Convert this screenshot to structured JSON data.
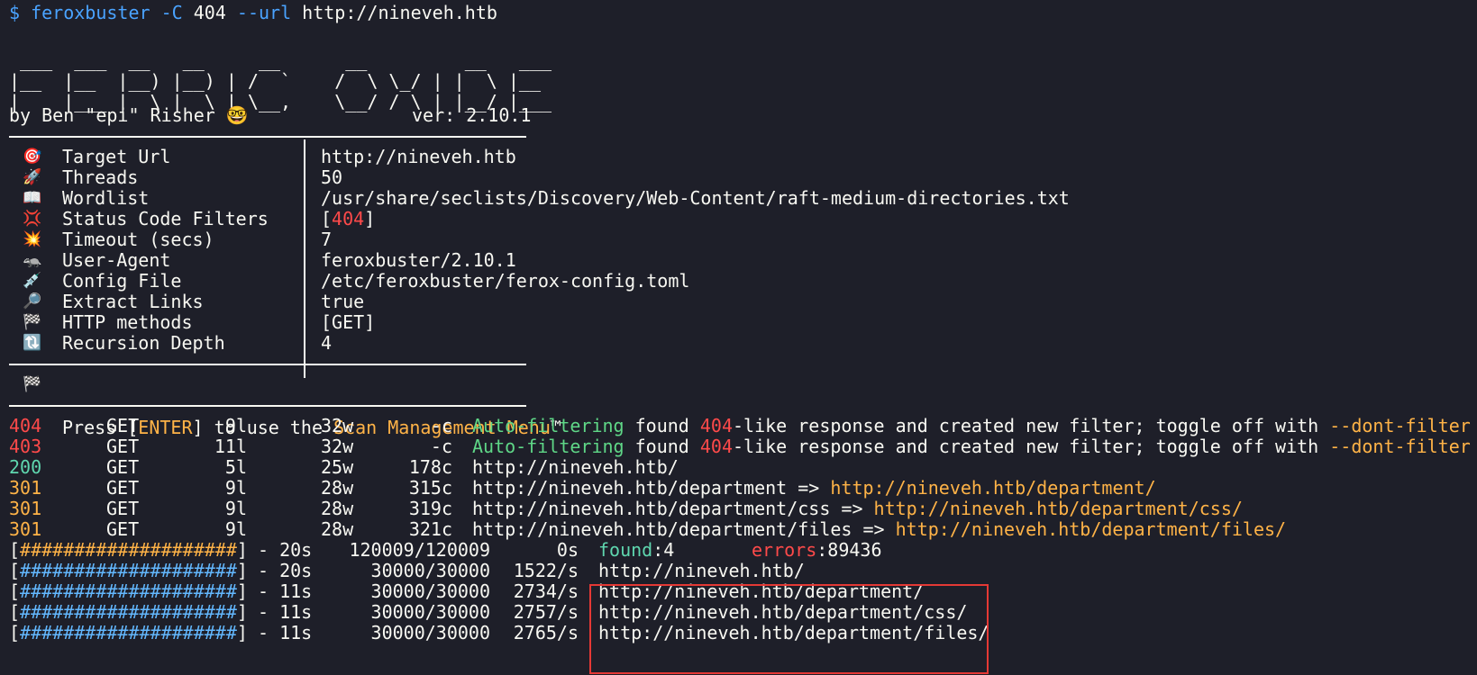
{
  "prompt": {
    "symbol": "$",
    "command": "feroxbuster",
    "flag1": "-C",
    "arg1": "404",
    "flag2": "--url",
    "arg2": "http://nineveh.htb"
  },
  "banner": {
    "ascii_art": " ___  ___  __   __     __      __         __   ___\n|__  |__  |__) |__) | /  `    /  \\ \\_/ | |  \\ |__\n|    |___ |  \\ |  \\ | \\__,    \\__/ / \\ | |__/ |___",
    "author": "by Ben \"epi\" Risher",
    "author_emoji": "🤓",
    "version": "ver: 2.10.1"
  },
  "config": [
    {
      "icon": "target-icon",
      "glyph": "🎯",
      "label": "Target Url",
      "value": "http://nineveh.htb"
    },
    {
      "icon": "rocket-icon",
      "glyph": "🚀",
      "label": "Threads",
      "value": "50"
    },
    {
      "icon": "book-icon",
      "glyph": "📖",
      "label": "Wordlist",
      "value": "/usr/share/seclists/Discovery/Web-Content/raft-medium-directories.txt"
    },
    {
      "icon": "collision-icon",
      "glyph": "💢",
      "label": "Status Code Filters",
      "value_prefix": "[",
      "value_code": "404",
      "value_suffix": "]"
    },
    {
      "icon": "boom-icon",
      "glyph": "💥",
      "label": "Timeout (secs)",
      "value": "7"
    },
    {
      "icon": "dog-icon",
      "glyph": "🦡",
      "label": "User-Agent",
      "value": "feroxbuster/2.10.1"
    },
    {
      "icon": "syringe-icon",
      "glyph": "💉",
      "label": "Config File",
      "value": "/etc/feroxbuster/ferox-config.toml"
    },
    {
      "icon": "magnifier-icon",
      "glyph": "🔎",
      "label": "Extract Links",
      "value": "true"
    },
    {
      "icon": "checkered-flag-icon",
      "glyph": "🏁",
      "label": "HTTP methods",
      "value": "[GET]"
    },
    {
      "icon": "loop-icon",
      "glyph": "🔃",
      "label": "Recursion Depth",
      "value": "4"
    }
  ],
  "menu_hint": {
    "glyph": "🏁",
    "pre": "Press ",
    "bracket_open": "[",
    "key": "ENTER",
    "bracket_close": "]",
    "mid": " to use the ",
    "menu": "Scan Management Menu",
    "tm": "™"
  },
  "results": [
    {
      "status": "404",
      "method": "GET",
      "lines": "9l",
      "words": "32w",
      "chars": "-c",
      "tag": "Auto-filtering",
      "msg1": " found ",
      "code": "404",
      "msg2": "-like response and created new filter; toggle off with ",
      "flag": "--dont-filter"
    },
    {
      "status": "403",
      "method": "GET",
      "lines": "11l",
      "words": "32w",
      "chars": "-c",
      "tag": "Auto-filtering",
      "msg1": " found ",
      "code": "404",
      "msg2": "-like response and created new filter; toggle off with ",
      "flag": "--dont-filter"
    },
    {
      "status": "200",
      "method": "GET",
      "lines": "5l",
      "words": "25w",
      "chars": "178c",
      "url": "http://nineveh.htb/"
    },
    {
      "status": "301",
      "method": "GET",
      "lines": "9l",
      "words": "28w",
      "chars": "315c",
      "url": "http://nineveh.htb/department",
      "arrow": " => ",
      "redirect": "http://nineveh.htb/department/"
    },
    {
      "status": "301",
      "method": "GET",
      "lines": "9l",
      "words": "28w",
      "chars": "319c",
      "url": "http://nineveh.htb/department/css",
      "arrow": " => ",
      "redirect": "http://nineveh.htb/department/css/"
    },
    {
      "status": "301",
      "method": "GET",
      "lines": "9l",
      "words": "28w",
      "chars": "321c",
      "url": "http://nineveh.htb/department/files",
      "arrow": " => ",
      "redirect": "http://nineveh.htb/department/files/"
    }
  ],
  "progress": {
    "overall": {
      "bar_open": "[",
      "bar": "####################",
      "bar_close": "]",
      "dash": "- 20s",
      "count": "120009/120009",
      "rate": "0s",
      "found_label": "found",
      "found_value": ":4",
      "errors_label": "errors",
      "errors_value": ":89436"
    },
    "rows": [
      {
        "bar_open": "[",
        "bar": "####################",
        "bar_close": "]",
        "dash": "- 20s",
        "count": "30000/30000",
        "rate": "1522/s",
        "url": "http://nineveh.htb/"
      },
      {
        "bar_open": "[",
        "bar": "####################",
        "bar_close": "]",
        "dash": "- 11s",
        "count": "30000/30000",
        "rate": "2734/s",
        "url": "http://nineveh.htb/department/"
      },
      {
        "bar_open": "[",
        "bar": "####################",
        "bar_close": "]",
        "dash": "- 11s",
        "count": "30000/30000",
        "rate": "2757/s",
        "url": "http://nineveh.htb/department/css/"
      },
      {
        "bar_open": "[",
        "bar": "####################",
        "bar_close": "]",
        "dash": "- 11s",
        "count": "30000/30000",
        "rate": "2765/s",
        "url": "http://nineveh.htb/department/files/"
      }
    ]
  },
  "colors": {
    "background": "#1e1f29",
    "prompt_blue": "#4aa3ff",
    "status_red": "#ff4a4a",
    "status_orange": "#ffb347",
    "status_green": "#5fd7af",
    "highlight_box": "#e53935"
  }
}
